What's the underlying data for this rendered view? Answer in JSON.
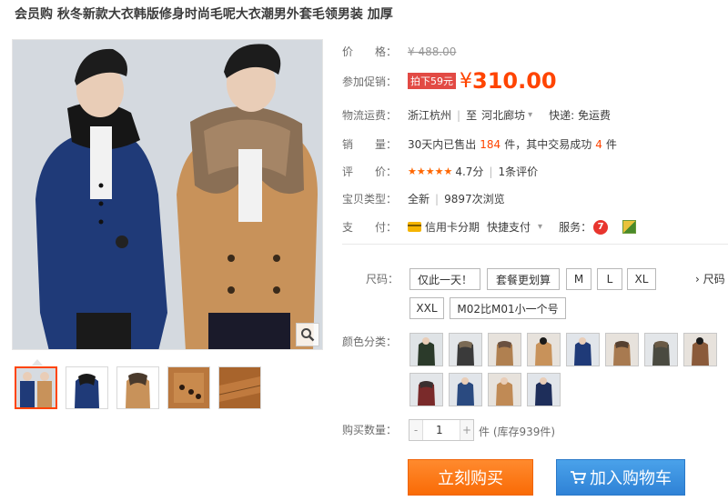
{
  "product": {
    "title": "会员购 秋冬新款大衣韩版修身时尚毛呢大衣潮男外套毛领男装 加厚"
  },
  "price": {
    "label": "价　　格：",
    "original": "¥ 488.00"
  },
  "promo": {
    "label": "参加促销：",
    "tag": "拍下59元",
    "currency": "¥",
    "value": "310.00"
  },
  "shipping": {
    "label": "物流运费：",
    "from": "浙江杭州",
    "to_prefix": "至",
    "to": "河北廊坊",
    "fee": "快递: 免运费"
  },
  "sales": {
    "label": "销　　量：",
    "prefix": "30天内已售出",
    "count": "184",
    "mid": "件，其中交易成功",
    "success": "4",
    "suffix": "件"
  },
  "rating": {
    "label": "评　　价：",
    "stars": "★★★★★",
    "score": "4.7分",
    "reviews": "1条评价"
  },
  "item_type": {
    "label": "宝贝类型：",
    "condition": "全新",
    "views": "9897次浏览"
  },
  "payment": {
    "label": "支　　付：",
    "credit": "信用卡分期",
    "quick": "快捷支付",
    "service_label": "服务："
  },
  "size": {
    "label": "尺码：",
    "options": [
      "仅此一天！",
      "套餐更划算",
      "M",
      "L",
      "XL",
      "XXL",
      "M02比M01小一个号"
    ],
    "more": "› 尺码"
  },
  "color": {
    "label": "颜色分类："
  },
  "quantity": {
    "label": "购买数量：",
    "value": "1",
    "stock": "件 (库存939件)",
    "minus": "-",
    "plus": "+"
  },
  "actions": {
    "buy": "立刻购买",
    "cart": "加入购物车"
  },
  "colors": {
    "accent": "#ff4400",
    "buy_button": "#f96b06",
    "cart_button": "#2f82d6",
    "navy_coat": "#1f3a78",
    "camel_coat": "#c8925a"
  }
}
